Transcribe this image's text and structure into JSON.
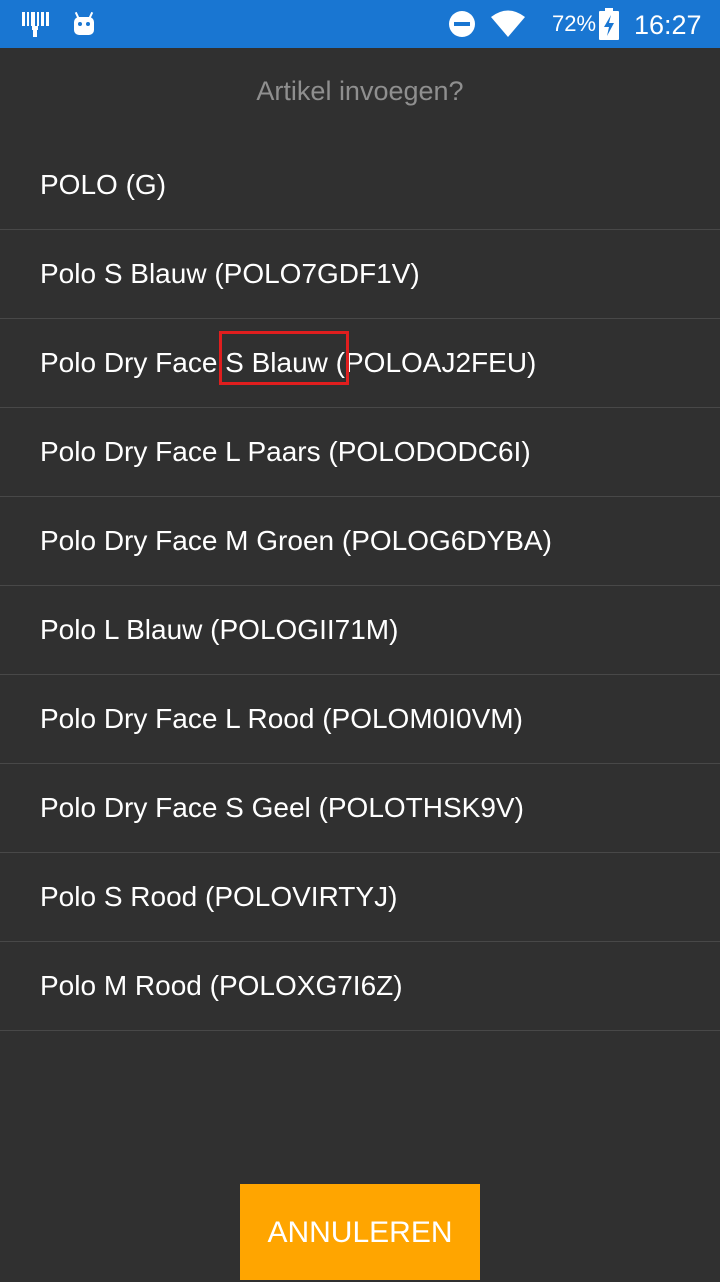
{
  "status_bar": {
    "icons": [
      "barcode-scanner-icon",
      "android-icon",
      "do-not-disturb-icon",
      "wifi-icon",
      "battery-charging-icon"
    ],
    "battery_percent": "72%",
    "time": "16:27"
  },
  "dialog": {
    "title": "Artikel invoegen?",
    "items": [
      {
        "label": "POLO (G)"
      },
      {
        "label": "Polo S Blauw (POLO7GDF1V)"
      },
      {
        "label": "Polo Dry Face S Blauw (POLOAJ2FEU)"
      },
      {
        "label": "Polo Dry Face L Paars (POLODODC6I)"
      },
      {
        "label": "Polo Dry Face M Groen (POLOG6DYBA)"
      },
      {
        "label": "Polo L Blauw (POLOGII71M)"
      },
      {
        "label": "Polo Dry Face L Rood (POLOM0I0VM)"
      },
      {
        "label": "Polo Dry Face S Geel (POLOTHSK9V)"
      },
      {
        "label": "Polo S Rood (POLOVIRTYJ)"
      },
      {
        "label": "Polo M Rood (POLOXG7I6Z)"
      }
    ],
    "cancel_label": "ANNULEREN"
  },
  "colors": {
    "status_bar": "#1976d2",
    "background": "#303030",
    "accent_button": "#ffa500",
    "highlight": "#e01e1e"
  }
}
